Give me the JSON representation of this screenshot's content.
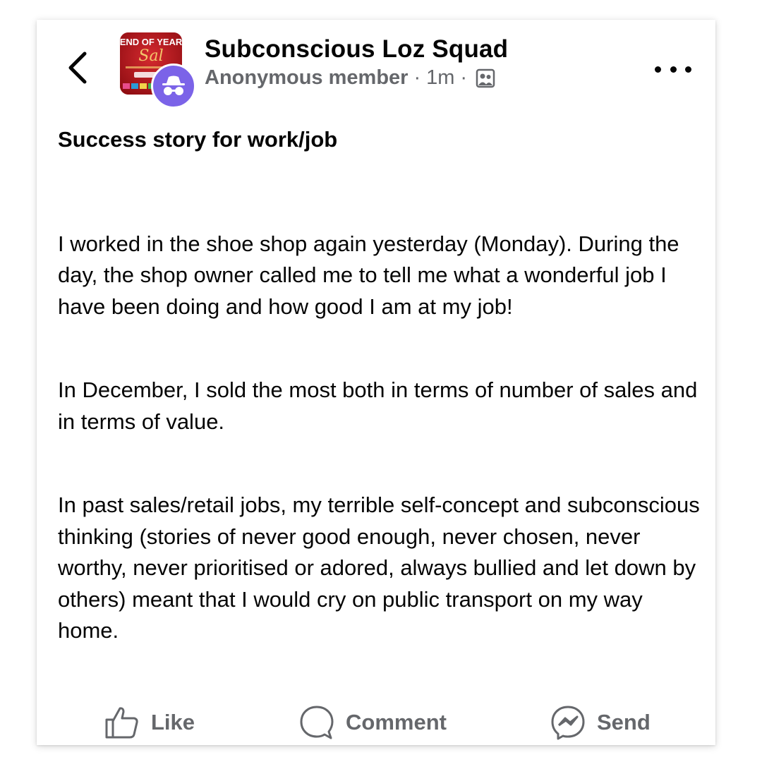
{
  "header": {
    "group_name": "Subconscious Loz Squad",
    "author": "Anonymous member",
    "separator": "·",
    "time": "1m",
    "thumbnail_text": "END OF YEAR"
  },
  "post": {
    "title": "Success story for work/job",
    "paragraphs": [
      "I worked in the shoe shop again yesterday (Monday). During the day, the shop owner called me to tell me what a wonderful job I have been doing and how good I am at my job!",
      "In December, I sold the most both in terms of number of sales and in terms of value.",
      "In past sales/retail jobs, my terrible self-concept and subconscious thinking (stories of never good enough, never chosen, never worthy, never prioritised or adored, always bullied and let down by others) meant that I would cry on public transport on my way home."
    ]
  },
  "actions": {
    "like": "Like",
    "comment": "Comment",
    "send": "Send"
  },
  "icons": {
    "back": "chevron-left-icon",
    "more": "more-horizontal-icon",
    "audience": "group-members-icon",
    "anonymous": "incognito-icon",
    "like": "thumbs-up-icon",
    "comment": "speech-bubble-icon",
    "send": "messenger-icon"
  },
  "colors": {
    "text": "#050505",
    "secondary_text": "#65676b",
    "anonymous_avatar": "#7b63e8",
    "thumbnail_red": "#b3141a"
  }
}
